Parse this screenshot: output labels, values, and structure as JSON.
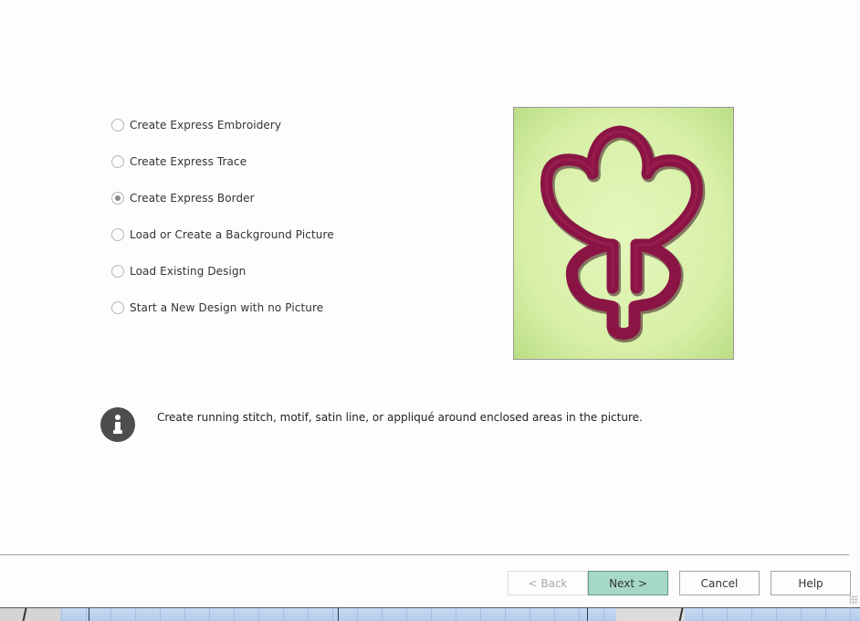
{
  "wizard": {
    "options": [
      {
        "label": "Create Express Embroidery",
        "checked": false
      },
      {
        "label": "Create Express Trace",
        "checked": false
      },
      {
        "label": "Create Express Border",
        "checked": true
      },
      {
        "label": "Load or Create a Background Picture",
        "checked": false
      },
      {
        "label": "Load Existing Design",
        "checked": false
      },
      {
        "label": "Start a New Design with no Picture",
        "checked": false
      }
    ],
    "selected_option": "Create Express Border",
    "preview_image": "flower-border-embroidery",
    "info": {
      "icon": "info-icon",
      "text": "Create running stitch, motif, satin line, or appliqué around enclosed areas in the picture."
    }
  },
  "buttons": {
    "back": "< Back",
    "back_enabled": false,
    "next": "Next >",
    "cancel": "Cancel",
    "help": "Help"
  },
  "colors": {
    "next_button_bg": "#a5d8c6",
    "preview_fabric": "#d8f0a8",
    "embroidery_thread": "#8a1444",
    "info_icon": "#4d4d4d"
  }
}
